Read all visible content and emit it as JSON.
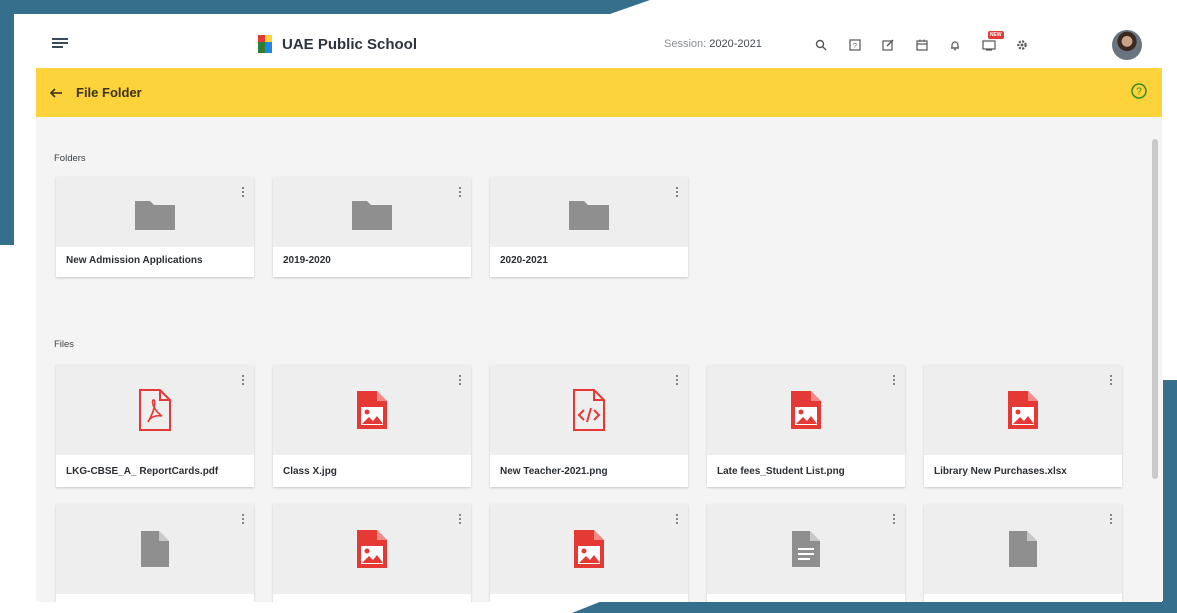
{
  "app": {
    "school_name": "UAE Public School",
    "session_label": "Session:",
    "session_value": "2020-2021",
    "new_badge": "NEW"
  },
  "page": {
    "title": "File Folder"
  },
  "sections": {
    "folders_label": "Folders",
    "files_label": "Files"
  },
  "folders": [
    {
      "name": "New Admission Applications"
    },
    {
      "name": "2019-2020"
    },
    {
      "name": "2020-2021"
    }
  ],
  "files": [
    {
      "name": "LKG-CBSE_A_ ReportCards.pdf",
      "icon": "pdf-file-icon"
    },
    {
      "name": "Class X.jpg",
      "icon": "image-file-icon"
    },
    {
      "name": "New Teacher-2021.png",
      "icon": "code-file-icon"
    },
    {
      "name": "Late fees_Student List.png",
      "icon": "image-file-icon"
    },
    {
      "name": "Library New Purchases.xlsx",
      "icon": "image-file-icon"
    },
    {
      "name": "",
      "icon": "generic-file-icon"
    },
    {
      "name": "",
      "icon": "image-file-icon"
    },
    {
      "name": "",
      "icon": "image-file-icon"
    },
    {
      "name": "",
      "icon": "document-file-icon"
    },
    {
      "name": "",
      "icon": "generic-file-icon"
    }
  ],
  "colors": {
    "accent_yellow": "#fdd33c",
    "file_red": "#e53935",
    "folder_gray": "#8f8f8f",
    "frame_blue": "#356f8c"
  }
}
